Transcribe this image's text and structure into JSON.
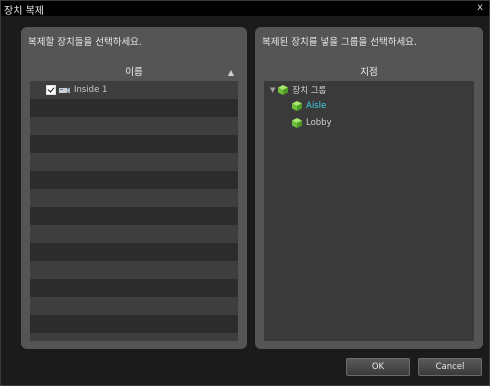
{
  "window": {
    "title": "장치 복제",
    "close_glyph": "x"
  },
  "left_panel": {
    "instruction": "복제할 장치들을 선택하세요.",
    "column_header": "이름",
    "sort_glyph": "▲",
    "devices": [
      {
        "name": "Inside 1",
        "checked": true
      }
    ]
  },
  "right_panel": {
    "instruction": "복제된 장치를 넣을 그룹을 선택하세요.",
    "column_header": "지점",
    "tree": {
      "expand_glyph": "▼",
      "root": "장치 그룹",
      "children": [
        "Aisle",
        "Lobby"
      ],
      "selected": "Aisle"
    }
  },
  "footer": {
    "ok_label": "OK",
    "cancel_label": "Cancel"
  },
  "colors": {
    "selected_text": "#3fd3e8",
    "cube_green": "#7ad04a"
  }
}
